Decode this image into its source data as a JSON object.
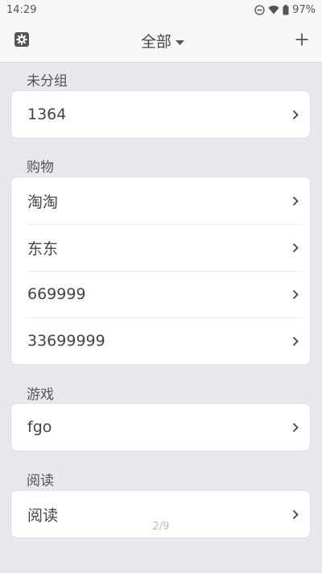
{
  "status_bar": {
    "time": "14:29",
    "battery": "97%",
    "icons": [
      "do-not-disturb-icon",
      "wifi-icon",
      "battery-icon"
    ]
  },
  "header": {
    "title": "全部",
    "icons": [
      "settings-icon",
      "dropdown-arrow-icon",
      "plus-icon"
    ]
  },
  "groups": [
    {
      "label": "未分组",
      "items": [
        "1364"
      ]
    },
    {
      "label": "购物",
      "items": [
        "淘淘",
        "东东",
        "669999",
        "33699999"
      ]
    },
    {
      "label": "游戏",
      "items": [
        "fgo"
      ]
    },
    {
      "label": "阅读",
      "items": [
        "阅读"
      ]
    }
  ],
  "page_indicator": "2/9",
  "colors": {
    "background": "#e8e8ef",
    "card": "#ffffff",
    "bar": "#f7f7f7",
    "text": "#444444"
  }
}
